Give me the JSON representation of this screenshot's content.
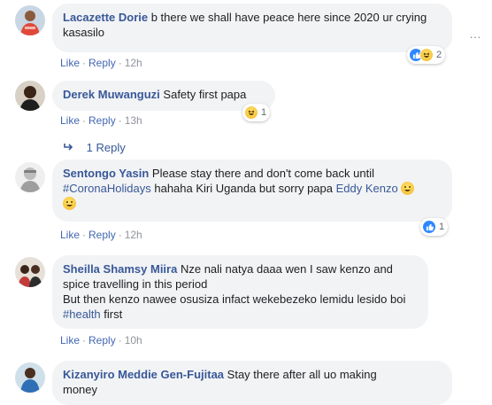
{
  "comments": [
    {
      "author": "Lacazette Dorie",
      "text": "b there we shall have peace here since 2020 ur crying kasasilo",
      "actions": {
        "like": "Like",
        "reply": "Reply",
        "time": "12h"
      },
      "reactions_count": "2"
    },
    {
      "author": "Derek Muwanguzi",
      "text": "Safety first papa",
      "actions": {
        "like": "Like",
        "reply": "Reply",
        "time": "13h"
      },
      "reactions_count": "1",
      "replies_label": "1 Reply"
    },
    {
      "author": "Sentongo Yasin",
      "text_before": "Please stay there and don't come back until",
      "hashtag": "#CoronaHolidays",
      "text_middle": "hahaha Kiri Uganda but sorry papa",
      "mention": "Eddy Kenzo",
      "actions": {
        "like": "Like",
        "reply": "Reply",
        "time": "12h"
      },
      "reactions_count": "1"
    },
    {
      "author": "Sheilla Shamsy Miira",
      "text_line1": "Nze nali natya daaa wen I saw kenzo and",
      "text_line2": "spice travelling in this period",
      "text_line3": "But then kenzo nawee osusiza infact wekebezeko lemidu lesido boi",
      "hashtag": "#health",
      "text_end": "first",
      "actions": {
        "like": "Like",
        "reply": "Reply",
        "time": "10h"
      }
    },
    {
      "author": "Kizanyiro Meddie Gen-Fujitaa",
      "text_line1": "Stay there after all uo making",
      "text_line2": "money"
    }
  ],
  "colors": {
    "author": "#385898",
    "bubble": "#f2f3f5",
    "action": "#4267b2",
    "like_blue": "#2d88ff",
    "haha_yellow": "#f5b52a"
  },
  "icons": [
    "like-reaction-icon",
    "haha-reaction-icon",
    "reply-arrow-icon",
    "more-options-icon",
    "grinning-emoji-icon"
  ]
}
